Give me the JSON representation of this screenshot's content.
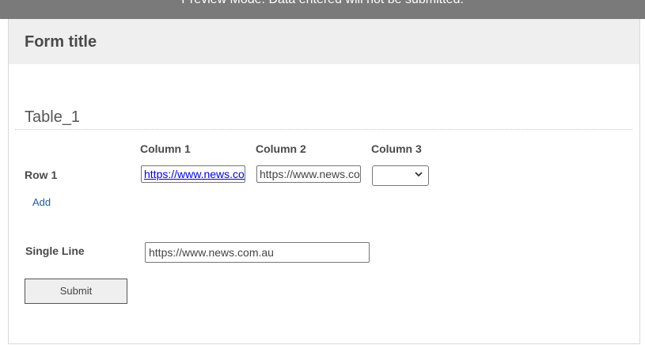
{
  "banner": {
    "text": "Preview Mode. Data entered will not be submitted."
  },
  "form": {
    "title": "Form title",
    "table": {
      "title": "Table_1",
      "columns": [
        "Column 1",
        "Column 2",
        "Column 3"
      ],
      "rows": [
        {
          "label": "Row 1",
          "cells": [
            "https://www.news.com.au",
            "https://www.news.com.au",
            ""
          ]
        }
      ],
      "add_label": "Add"
    },
    "single_line": {
      "label": "Single Line",
      "value": "https://www.news.com.au"
    },
    "submit_label": "Submit"
  },
  "icons": {
    "select_arrow": "chevron-down-icon"
  },
  "colors": {
    "banner_bg": "#7a7a7a",
    "header_bg": "#efefef",
    "link": "#1a5fa8",
    "hyperlink": "#0000ee"
  }
}
